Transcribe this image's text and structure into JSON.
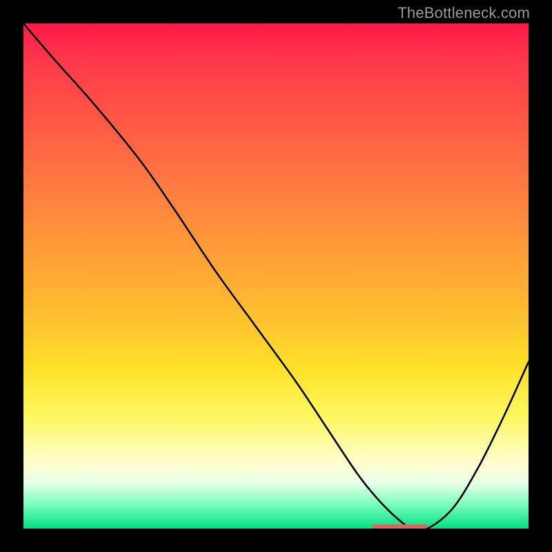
{
  "watermark": "TheBottleneck.com",
  "colors": {
    "frame": "#000000",
    "bg": "#000000",
    "curve": "#000000",
    "marker": "#d46a5f"
  },
  "chart_data": {
    "type": "line",
    "title": "",
    "xlabel": "",
    "ylabel": "",
    "xlim": [
      0,
      100
    ],
    "ylim": [
      0,
      100
    ],
    "series": [
      {
        "name": "bottleneck-curve",
        "x": [
          0,
          6,
          14,
          23,
          30,
          38,
          46,
          54,
          60,
          66,
          70,
          74,
          77,
          80,
          85,
          90,
          95,
          100
        ],
        "y": [
          100,
          93,
          84,
          73,
          63,
          51,
          40,
          29,
          20,
          11,
          6,
          2,
          0,
          0,
          4,
          12,
          22,
          33
        ]
      }
    ],
    "optimum_marker": {
      "x_start": 69,
      "x_end": 80,
      "y": 0
    },
    "gradient_stops": [
      {
        "pos": 0,
        "color": "#ff1a4a"
      },
      {
        "pos": 50,
        "color": "#ffba30"
      },
      {
        "pos": 80,
        "color": "#fff862"
      },
      {
        "pos": 100,
        "color": "#00e080"
      }
    ]
  }
}
